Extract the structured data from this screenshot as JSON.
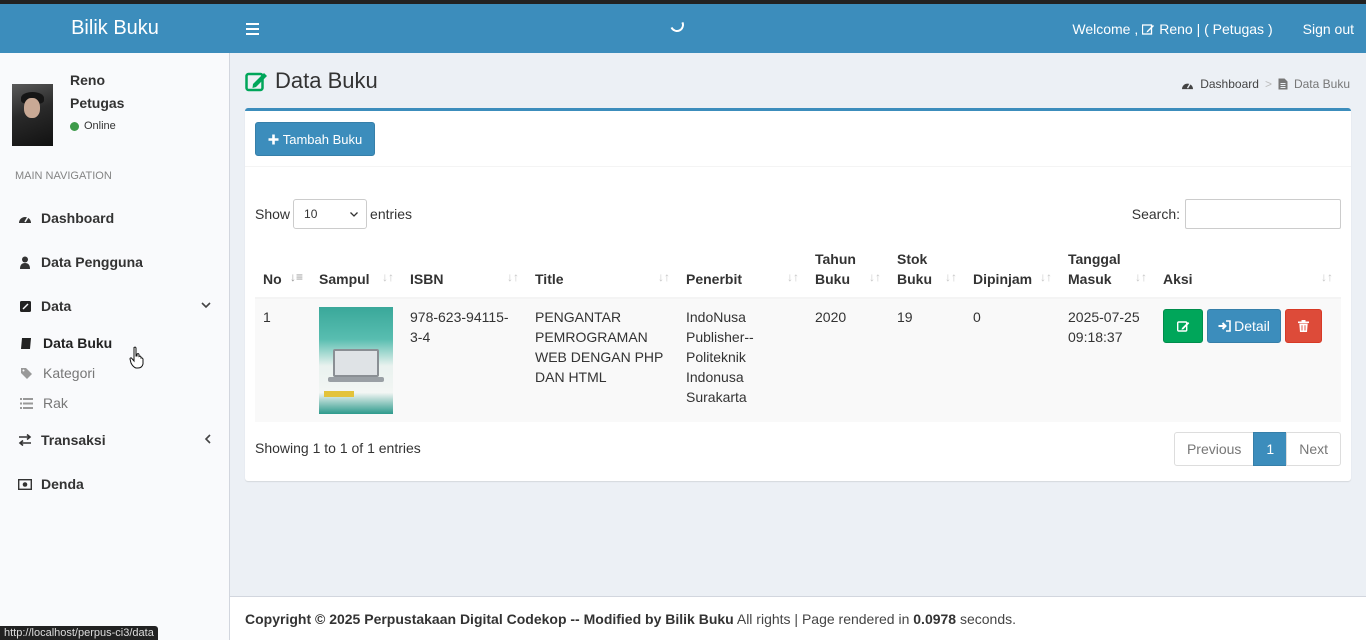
{
  "colors": {
    "header": "#3c8dbc",
    "primary": "#3c8dbc",
    "success": "#00a65a",
    "danger": "#dd4b39",
    "online": "#3d9a4a"
  },
  "header": {
    "brand": "Bilik Buku",
    "welcome_prefix": "Welcome ,",
    "welcome_user": "Reno | ( Petugas )",
    "signout": "Sign out"
  },
  "user": {
    "name": "Reno",
    "role": "Petugas",
    "status": "Online"
  },
  "sidebar": {
    "nav_header": "MAIN NAVIGATION",
    "items": [
      {
        "label": "Dashboard",
        "icon": "dashboard-icon"
      },
      {
        "label": "Data Pengguna",
        "icon": "user-icon"
      },
      {
        "label": "Data",
        "icon": "book-icon"
      },
      {
        "label": "Transaksi",
        "icon": "exchange-icon"
      },
      {
        "label": "Denda",
        "icon": "money-icon"
      }
    ],
    "sub_items": [
      {
        "label": "Data Buku",
        "icon": "book-icon"
      },
      {
        "label": "Kategori",
        "icon": "tags-icon"
      },
      {
        "label": "Rak",
        "icon": "list-icon"
      }
    ]
  },
  "page": {
    "title": "Data Buku"
  },
  "breadcrumb": {
    "home": "Dashboard",
    "current": "Data Buku"
  },
  "toolbar": {
    "add_label": "Tambah Buku"
  },
  "datatable": {
    "show_label": "Show",
    "entries_value": "10",
    "entries_label": "entries",
    "search_label": "Search:",
    "columns": [
      "No",
      "Sampul",
      "ISBN",
      "Title",
      "Penerbit",
      "Tahun Buku",
      "Stok Buku",
      "Dipinjam",
      "Tanggal Masuk",
      "Aksi"
    ],
    "rows": [
      {
        "no": "1",
        "isbn": "978-623-94115-3-4",
        "title": "PENGANTAR PEMROGRAMAN WEB DENGAN PHP DAN HTML",
        "penerbit": "IndoNusa Publisher--Politeknik Indonusa Surakarta",
        "tahun": "2020",
        "stok": "19",
        "dipinjam": "0",
        "tanggal": "2025-07-25 09:18:37",
        "detail_label": "Detail"
      }
    ],
    "info": "Showing 1 to 1 of 1 entries",
    "pagination": {
      "previous": "Previous",
      "current": "1",
      "next": "Next"
    }
  },
  "footer": {
    "copyright": "Copyright © 2025 Perpustakaan Digital Codekop -- Modified by Bilik Buku",
    "rights": " All rights | Page rendered in ",
    "time": "0.0978",
    "suffix": " seconds."
  },
  "status_bar": {
    "url": "http://localhost/perpus-ci3/data"
  }
}
